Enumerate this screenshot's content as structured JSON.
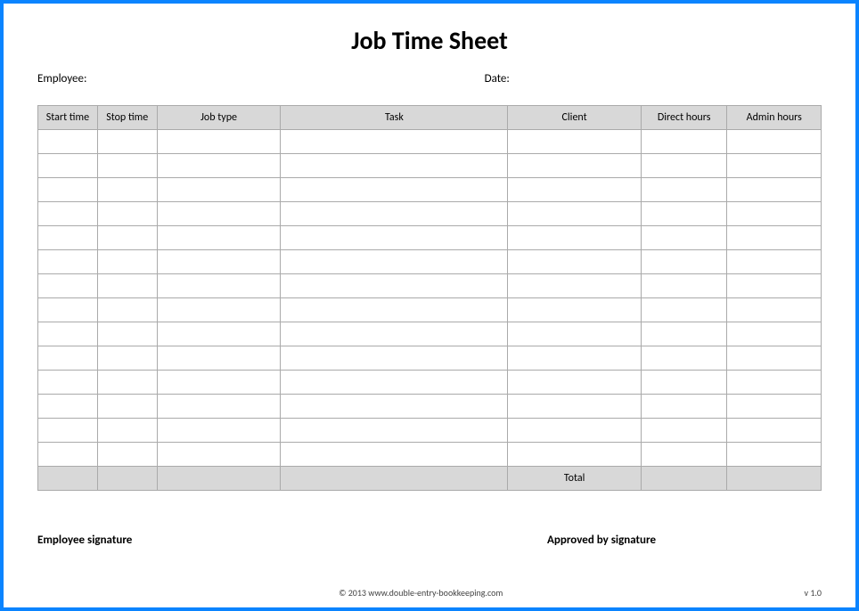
{
  "title": "Job Time Sheet",
  "labels": {
    "employee": "Employee:",
    "date": "Date:",
    "employee_signature": "Employee signature",
    "approved_signature": "Approved by signature"
  },
  "columns": {
    "start_time": "Start time",
    "stop_time": "Stop time",
    "job_type": "Job type",
    "task": "Task",
    "client": "Client",
    "direct_hours": "Direct hours",
    "admin_hours": "Admin hours"
  },
  "total_label": "Total",
  "row_count": 14,
  "footer": {
    "copyright": "© 2013 www.double-entry-bookkeeping.com",
    "version": "v 1.0"
  }
}
